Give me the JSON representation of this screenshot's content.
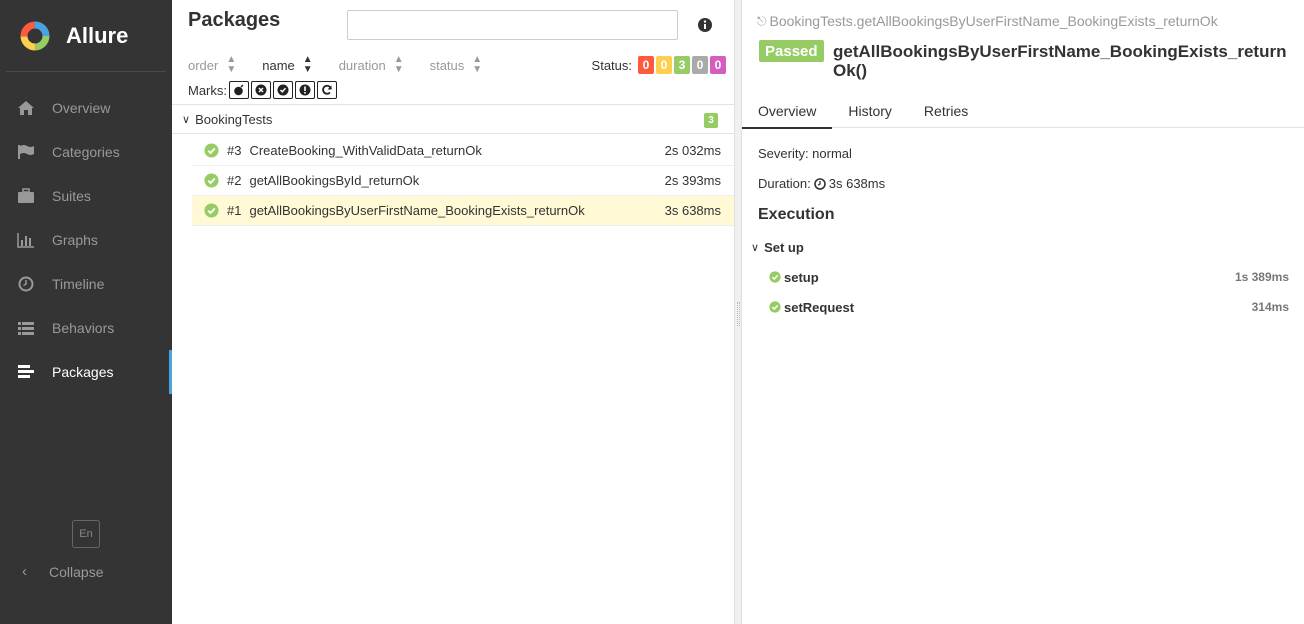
{
  "app": {
    "name": "Allure"
  },
  "sidebar": {
    "items": [
      {
        "label": "Overview",
        "icon": "home-icon"
      },
      {
        "label": "Categories",
        "icon": "flag-icon"
      },
      {
        "label": "Suites",
        "icon": "briefcase-icon"
      },
      {
        "label": "Graphs",
        "icon": "bar-chart-icon"
      },
      {
        "label": "Timeline",
        "icon": "clock-icon"
      },
      {
        "label": "Behaviors",
        "icon": "list-icon"
      },
      {
        "label": "Packages",
        "icon": "align-left-icon",
        "active": true
      }
    ],
    "language": "En",
    "collapse_label": "Collapse"
  },
  "packages": {
    "title": "Packages",
    "search_placeholder": "",
    "sort": [
      {
        "label": "order"
      },
      {
        "label": "name",
        "active": true
      },
      {
        "label": "duration"
      },
      {
        "label": "status"
      }
    ],
    "status_label": "Status:",
    "status_counts": [
      {
        "value": "0",
        "color": "#fd5a3e"
      },
      {
        "value": "0",
        "color": "#ffd050"
      },
      {
        "value": "3",
        "color": "#97cc64"
      },
      {
        "value": "0",
        "color": "#aaaaaa"
      },
      {
        "value": "0",
        "color": "#d35ebe"
      }
    ],
    "marks_label": "Marks:",
    "group": {
      "name": "BookingTests",
      "count": "3"
    },
    "tests": [
      {
        "num": "#3",
        "name": "CreateBooking_WithValidData_returnOk",
        "duration": "2s 032ms"
      },
      {
        "num": "#2",
        "name": "getAllBookingsById_returnOk",
        "duration": "2s 393ms"
      },
      {
        "num": "#1",
        "name": "getAllBookingsByUserFirstName_BookingExists_returnOk",
        "duration": "3s 638ms",
        "selected": true
      }
    ]
  },
  "detail": {
    "path": "BookingTests.getAllBookingsByUserFirstName_BookingExists_returnOk",
    "status": "Passed",
    "title": "getAllBookingsByUserFirstName_BookingExists_returnOk()",
    "tabs": [
      "Overview",
      "History",
      "Retries"
    ],
    "severity": "Severity: normal",
    "duration_label": "Duration:",
    "duration_value": "3s 638ms",
    "execution_title": "Execution",
    "setup_title": "Set up",
    "steps": [
      {
        "name": "setup",
        "duration": "1s 389ms"
      },
      {
        "name": "setRequest",
        "duration": "314ms"
      }
    ]
  },
  "colors": {
    "passed": "#97cc64",
    "sidebar_bg": "#343434",
    "selected_row": "#fff9d5",
    "active_nav_bar": "#4aa3df"
  }
}
